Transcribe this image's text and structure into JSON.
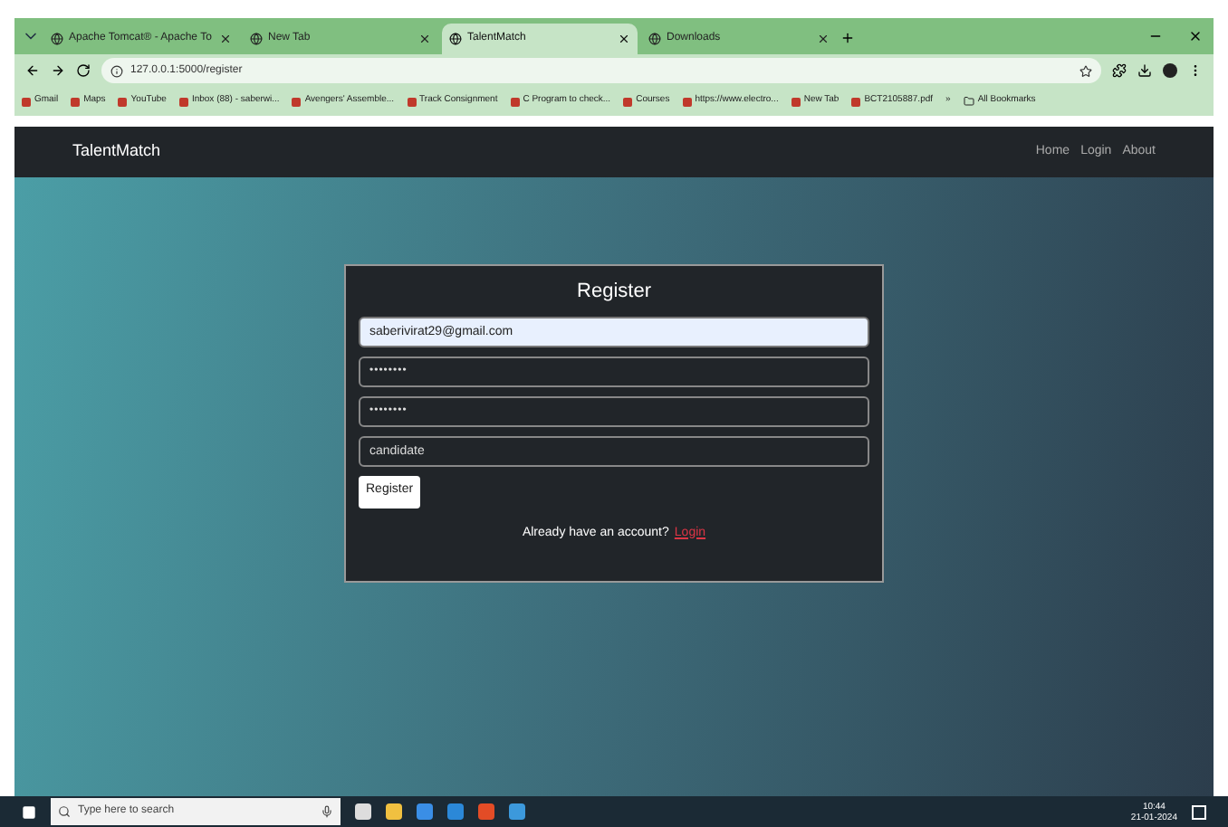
{
  "browser": {
    "tabs": [
      {
        "label": "Apache Tomcat® - Apache To",
        "selected": false
      },
      {
        "label": "New Tab",
        "selected": false
      },
      {
        "label": "TalentMatch",
        "selected": true
      },
      {
        "label": "Downloads",
        "selected": false
      }
    ],
    "url": "127.0.0.1:5000/register",
    "bookmarks": [
      "Gmail",
      "Maps",
      "YouTube",
      "Inbox (88) - saberwi...",
      "Avengers' Assemble...",
      "Track Consignment",
      "C Program to check...",
      "Courses",
      "https://www.electro...",
      "New Tab",
      "BCT2105887.pdf"
    ],
    "more": "»",
    "all_bookmarks": "All Bookmarks"
  },
  "navbar": {
    "brand": "TalentMatch",
    "links": [
      "Home",
      "Login",
      "About"
    ]
  },
  "form": {
    "title": "Register",
    "fields": [
      {
        "kind": "email",
        "value": "saberivirat29@gmail.com",
        "autofilled": true
      },
      {
        "kind": "password",
        "value": "••••••••",
        "autofilled": false
      },
      {
        "kind": "password",
        "value": "••••••••",
        "autofilled": false
      },
      {
        "kind": "select",
        "value": "candidate",
        "autofilled": false
      }
    ],
    "button": "Register",
    "footer": "Already have an account?",
    "footer_link": "Login"
  },
  "taskbar": {
    "search_placeholder": "Type here to search",
    "time": "10:44",
    "date": "21-01-2024"
  }
}
